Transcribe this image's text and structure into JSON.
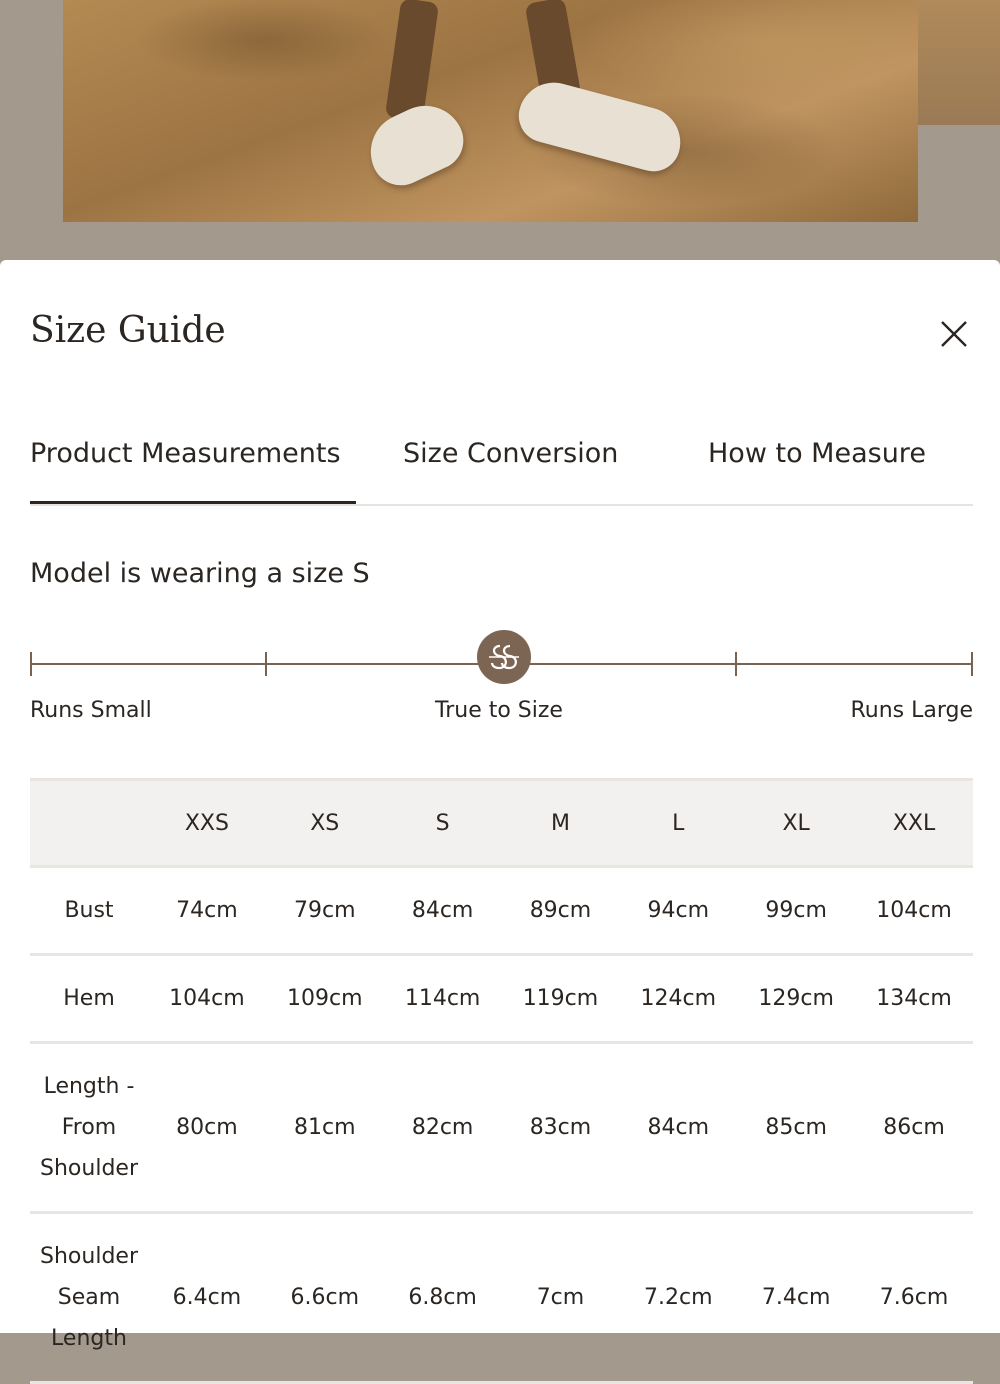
{
  "sheet": {
    "title": "Size Guide",
    "close_icon": "close-icon",
    "tabs": [
      {
        "label": "Product Measurements",
        "active": true
      },
      {
        "label": "Size Conversion",
        "active": false
      },
      {
        "label": "How to Measure",
        "active": false
      }
    ],
    "model_note": "Model is wearing a size S",
    "fit": {
      "left_label": "Runs Small",
      "center_label": "True to Size",
      "right_label": "Runs Large",
      "marker_icon": "brand-logo-icon",
      "marker_color": "#7d6554"
    }
  },
  "table": {
    "sizes": [
      "XXS",
      "XS",
      "S",
      "M",
      "L",
      "XL",
      "XXL"
    ],
    "rows": [
      {
        "label": "Bust",
        "values": [
          "74cm",
          "79cm",
          "84cm",
          "89cm",
          "94cm",
          "99cm",
          "104cm"
        ]
      },
      {
        "label": "Hem",
        "values": [
          "104cm",
          "109cm",
          "114cm",
          "119cm",
          "124cm",
          "129cm",
          "134cm"
        ]
      },
      {
        "label": "Length - From Shoulder",
        "values": [
          "80cm",
          "81cm",
          "82cm",
          "83cm",
          "84cm",
          "85cm",
          "86cm"
        ]
      },
      {
        "label": "Shoulder Seam Length",
        "values": [
          "6.4cm",
          "6.6cm",
          "6.8cm",
          "7cm",
          "7.2cm",
          "7.4cm",
          "7.6cm"
        ]
      }
    ]
  },
  "colors": {
    "text": "#2b2622",
    "accent": "#7d6554",
    "header_bg": "#f2f1ef"
  }
}
